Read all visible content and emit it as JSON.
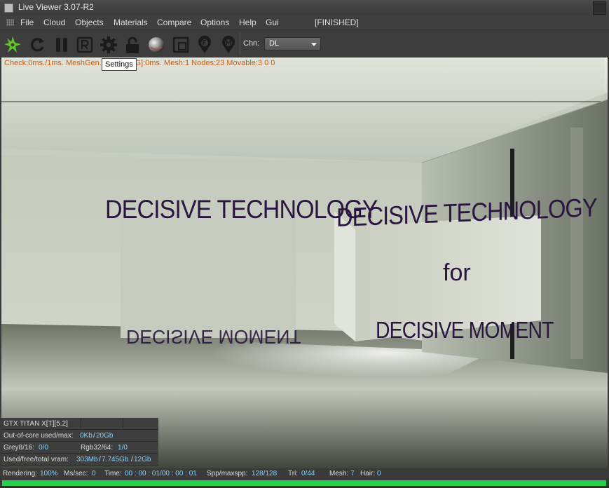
{
  "window": {
    "title": "Live Viewer 3.07-R2"
  },
  "menu": {
    "items": [
      "File",
      "Cloud",
      "Objects",
      "Materials",
      "Compare",
      "Options",
      "Help",
      "Gui"
    ],
    "status": "[FINISHED]"
  },
  "toolbar": {
    "buttons": [
      {
        "icon": "octane-logo-icon",
        "color": "#5fc72c"
      },
      {
        "icon": "refresh-icon"
      },
      {
        "icon": "pause-icon"
      },
      {
        "icon": "restart-r-icon"
      },
      {
        "icon": "gear-icon"
      },
      {
        "icon": "lock-icon"
      },
      {
        "icon": "sphere-icon"
      },
      {
        "icon": "region-select-icon"
      },
      {
        "icon": "focus-picker-icon"
      },
      {
        "icon": "material-picker-icon"
      }
    ],
    "channel_label": "Chn:",
    "channel_value": "DL"
  },
  "tooltip": {
    "text": "Settings"
  },
  "viewport": {
    "stats_line": "Check:0ms./1ms. MeshGen... Update[G]:0ms. Mesh:1 Nodes:23 Movable:3  0 0",
    "scene": {
      "wall_left_text_top": "DECISIVE TECHNOLOGY",
      "wall_left_text_bottom": "DECISIVE MOMENT",
      "wall_right_text_top": "DECISIVE TECHNOLOGY",
      "wall_right_text_middle": "for",
      "wall_right_text_bottom": "DECISIVE MOMENT"
    }
  },
  "gpu": {
    "name": "GTX TITAN X[T][5.2]",
    "out_of_core_label": "Out-of-core used/max:",
    "out_of_core_used": "0Kb",
    "out_of_core_max": "20Gb",
    "grey_label": "Grey8/16:",
    "grey_value": "0/0",
    "rgb_label": "Rgb32/64:",
    "rgb_value": "1/0",
    "vram_label": "Used/free/total vram:",
    "vram_used": "303Mb",
    "vram_free": "7.745Gb",
    "vram_total": "12Gb"
  },
  "status": {
    "rendering_label": "Rendering:",
    "rendering_value": "100%",
    "mssec_label": "Ms/sec:",
    "mssec_value": "0",
    "time_label": "Time:",
    "time_value": "00 : 00 : 01/00 : 00 : 01",
    "spp_label": "Spp/maxspp:",
    "spp_value": "128/128",
    "tri_label": "Tri:",
    "tri_value": "0/44",
    "mesh_label": "Mesh:",
    "mesh_value": "7",
    "hair_label": "Hair:",
    "hair_value": "0",
    "progress": 1.0
  },
  "colors": {
    "accent_green": "#25d04b",
    "stats_orange": "#cc5a10",
    "value_cyan": "#7fd3ff",
    "text_ink": "#2a1640"
  }
}
